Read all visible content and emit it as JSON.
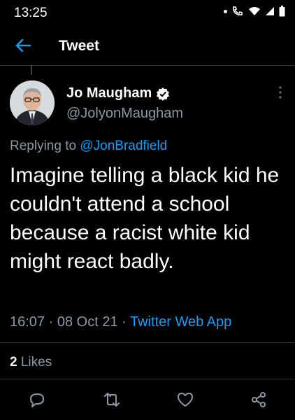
{
  "status_bar": {
    "time": "13:25"
  },
  "header": {
    "title": "Tweet"
  },
  "tweet": {
    "author_name": "Jo Maugham",
    "author_handle": "@JolyonMaugham",
    "replying_prefix": "Replying to",
    "replying_to": "@JonBradfield",
    "text": "Imagine telling a black kid he couldn't attend a school because a racist white kid might react badly.",
    "time": "16:07",
    "date": "08 Oct 21",
    "source": "Twitter Web App",
    "like_count": "2",
    "likes_label": "Likes"
  },
  "colors": {
    "accent": "#1d9bf0",
    "muted": "#8b98a5",
    "divider": "#2f3336"
  },
  "icons": [
    "back-arrow-icon",
    "verified-badge-icon",
    "more-vertical-icon",
    "reply-icon",
    "retweet-icon",
    "like-icon",
    "share-icon"
  ]
}
